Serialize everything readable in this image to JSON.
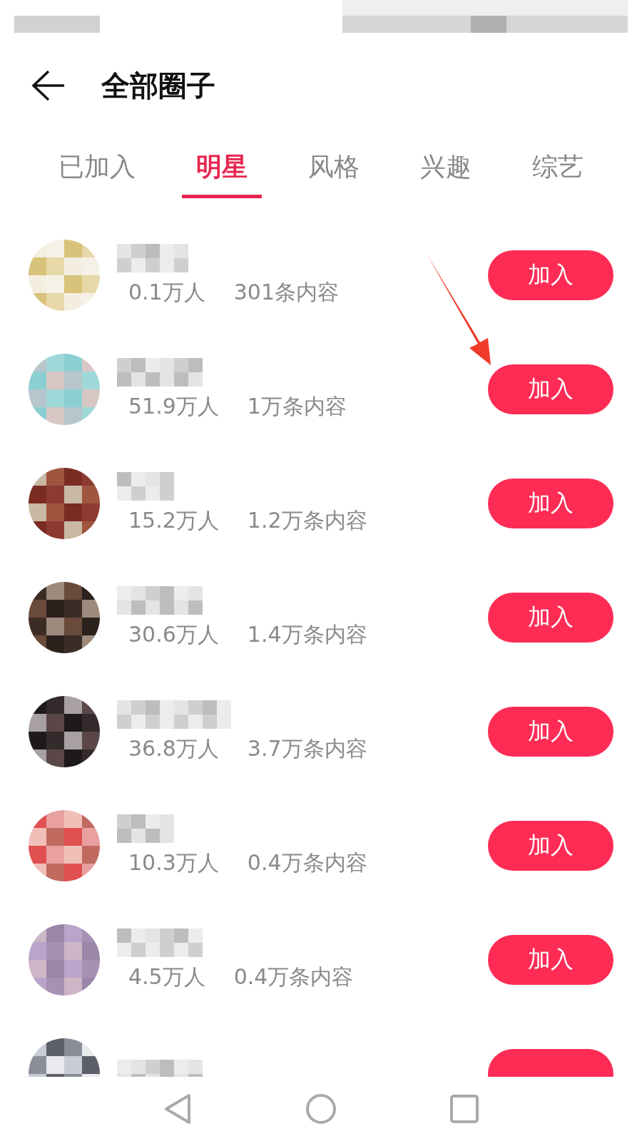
{
  "header": {
    "title": "全部圈子"
  },
  "tabs": [
    {
      "label": "已加入",
      "selected": false
    },
    {
      "label": "明星",
      "selected": true
    },
    {
      "label": "风格",
      "selected": false
    },
    {
      "label": "兴趣",
      "selected": false
    },
    {
      "label": "综艺",
      "selected": false
    }
  ],
  "circles": [
    {
      "members": "0.1万人",
      "posts": "301条内容",
      "button": "加入"
    },
    {
      "members": "51.9万人",
      "posts": "1万条内容",
      "button": "加入"
    },
    {
      "members": "15.2万人",
      "posts": "1.2万条内容",
      "button": "加入"
    },
    {
      "members": "30.6万人",
      "posts": "1.4万条内容",
      "button": "加入"
    },
    {
      "members": "36.8万人",
      "posts": "3.7万条内容",
      "button": "加入"
    },
    {
      "members": "10.3万人",
      "posts": "0.4万条内容",
      "button": "加入"
    },
    {
      "members": "4.5万人",
      "posts": "0.4万条内容",
      "button": "加入"
    },
    {
      "partial": true
    }
  ]
}
